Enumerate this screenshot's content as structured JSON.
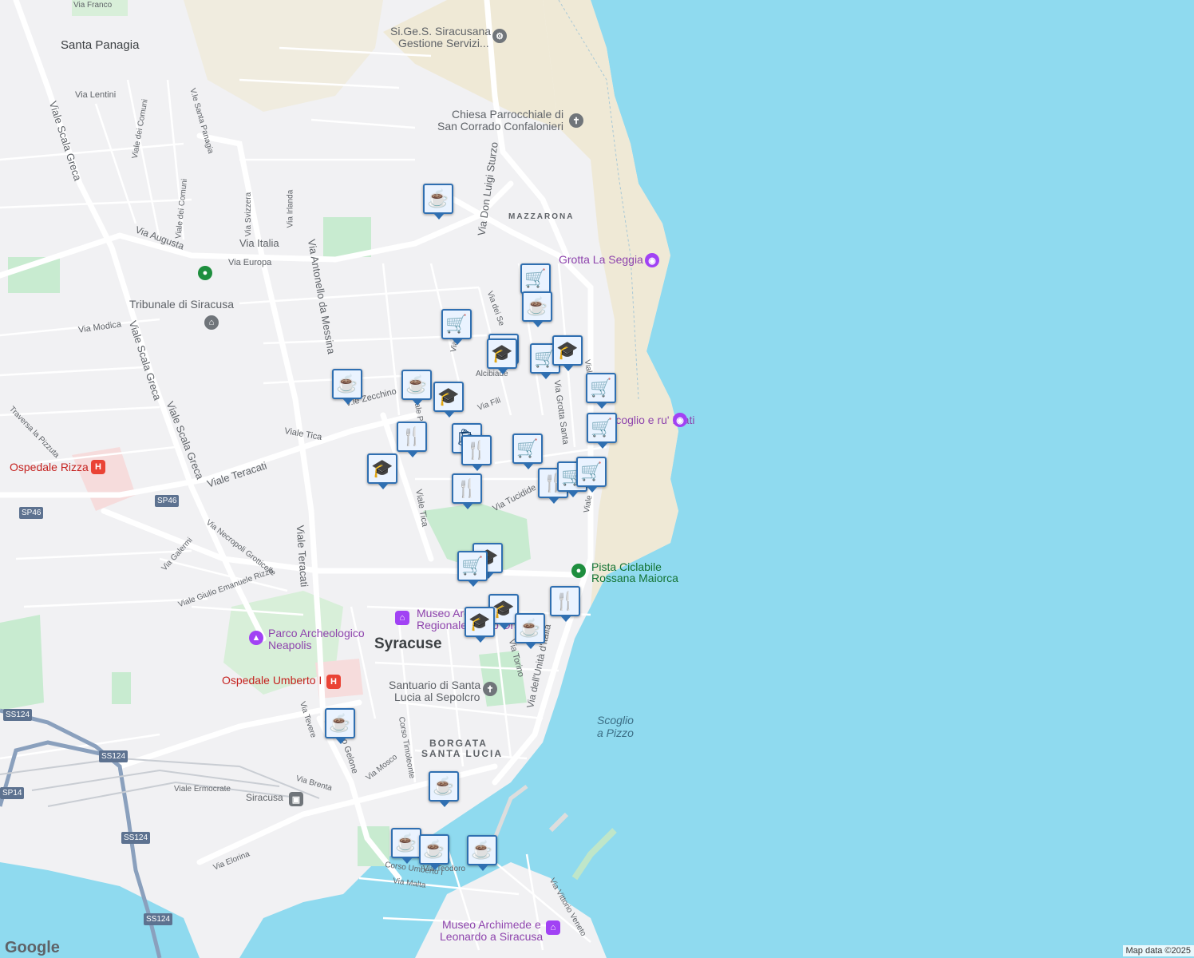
{
  "map": {
    "colors": {
      "sea": "#8fdaef",
      "land": "#f1f1f3",
      "road": "#ffffff",
      "park": "#c8ebd0",
      "beach": "#efe9d6",
      "highway": "#8aa0bd"
    },
    "labels": {
      "santa_panagia": "Santa Panagia",
      "syracuse": "Syracuse",
      "mazzarona": "MAZZARONA",
      "borgata": "BORGATA",
      "santa_lucia": "SANTA LUCIA",
      "scoglio_1": "Scoglio",
      "scoglio_2": "a Pizzo",
      "via_augusta": "Via Augusta",
      "via_italia": "Via Italia",
      "via_europa": "Via Europa",
      "via_lentini": "Via Lentini",
      "via_modica": "Via Modica",
      "viale_scala_greca_1": "Viale Scala Greca",
      "viale_scala_greca_2": "Viale Scala Greca",
      "viale_scala_greca_3": "Viale Scala Greca",
      "viale_teracati_1": "Viale Teracati",
      "viale_teracati_2": "Viale Teracati",
      "viale_tica_1": "Viale Tica",
      "viale_tica_2": "Viale Tica",
      "via_tucidide": "Via Tucidide",
      "via_grotta_santa": "Via Grotta Santa",
      "via_torino": "Via Torino",
      "via_unita": "Via dell'Unità d'Italia",
      "via_don_sturzo": "Via Don Luigi Sturzo",
      "via_antonello": "Via Antonello da Messina",
      "vle_zecchino": "V.le Zecchino",
      "via_irlanda": "Via Irlanda",
      "via_svizzera": "Via Svizzera",
      "viale_comuni_1": "Viale dei Comuni",
      "viale_comuni_2": "Viale dei Comuni",
      "vle_santa_panagia": "V.le Santa Panagia",
      "via_necropoli": "Via Necropoli Grotticelle",
      "via_galermi": "Via Galermi",
      "viale_giulio": "Viale Giulio Emanuele Rizzo",
      "traversa": "Traversa la Pizzuta",
      "via_tevere": "Via Tevere",
      "corso_gelone": "Corso Gelone",
      "via_mosco": "Via Mosco",
      "corso_timoleonte": "Corso Timoleonte",
      "via_brenta": "Via Brenta",
      "viale_ermocrate": "Viale Ermocrate",
      "via_elorina": "Via Elorina",
      "corso_umberto": "Corso Umberto I",
      "via_malta": "Via Malta",
      "via_vittorio_veneto": "Via Vittorio Veneto",
      "via_teodoro": "Via Teodoro",
      "via_francofonte": "Via Franco",
      "via_alcibiade": "Alcibiade",
      "via_fil_1": "Via Fili",
      "via_fil_2": "Via Fili",
      "via_del_sel": "Via dei Se",
      "viale_short": "Viale",
      "viale_short2": "Viale",
      "viale_paolo": "Viale Paolo",
      "sp46": "SP46",
      "ss124_1": "SS124",
      "ss124_2": "SS124",
      "ss124_3": "SS124",
      "ss124_4": "SS124",
      "sp14": "SP14"
    },
    "pois": {
      "sige_1": "Si.Ge.S. Siracusana",
      "sige_2": "Gestione Servizi...",
      "chiesa_1": "Chiesa Parrocchiale di",
      "chiesa_2": "San Corrado Confalonieri",
      "grotta": "Grotta La Seggia",
      "tribunale": "Tribunale di Siracusa",
      "ospedale_rizza": "Ospedale Rizza",
      "scoglio_frati": "Scoglio e ru' Frati",
      "pista_1": "Pista Ciclabile",
      "pista_2": "Rossana Maiorca",
      "museo_1": "Museo Archeologico",
      "museo_2": "Regionale Paolo Orsi",
      "parco_1": "Parco Archeologico",
      "parco_2": "Neapolis",
      "ospedale_umberto": "Ospedale Umberto I",
      "santuario_1": "Santuario di Santa",
      "santuario_2": "Lucia al Sepolcro",
      "siracusa_station": "Siracusa",
      "museo_arch_1": "Museo Archimede e",
      "museo_arch_2": "Leonardo a Siracusa"
    },
    "markers": [
      {
        "kind": "cafe",
        "icon": "coffee-cup-icon",
        "glyph": "☕"
      },
      {
        "kind": "shop",
        "icon": "shopping-cart-icon",
        "glyph": "🛒"
      },
      {
        "kind": "cafe",
        "icon": "coffee-cup-icon",
        "glyph": "☕"
      },
      {
        "kind": "shop",
        "icon": "shopping-cart-icon",
        "glyph": "🛒"
      },
      {
        "kind": "school",
        "icon": "graduation-cap-icon",
        "glyph": "🎓"
      },
      {
        "kind": "school",
        "icon": "graduation-cap-icon",
        "glyph": "🎓"
      },
      {
        "kind": "shop",
        "icon": "shopping-cart-icon",
        "glyph": "🛒"
      },
      {
        "kind": "school",
        "icon": "graduation-cap-icon",
        "glyph": "🎓"
      },
      {
        "kind": "cafe",
        "icon": "coffee-cup-icon",
        "glyph": "☕"
      },
      {
        "kind": "cafe",
        "icon": "coffee-cup-icon",
        "glyph": "☕"
      },
      {
        "kind": "school",
        "icon": "graduation-cap-icon",
        "glyph": "🎓"
      },
      {
        "kind": "shop",
        "icon": "shopping-cart-icon",
        "glyph": "🛒"
      },
      {
        "kind": "shop",
        "icon": "shopping-cart-icon",
        "glyph": "🛒"
      },
      {
        "kind": "restaurant",
        "icon": "fork-knife-icon",
        "glyph": "🍴"
      },
      {
        "kind": "shop",
        "icon": "shopping-bag-icon",
        "glyph": "🛍"
      },
      {
        "kind": "restaurant",
        "icon": "fork-knife-icon",
        "glyph": "🍴"
      },
      {
        "kind": "shop",
        "icon": "shopping-cart-icon",
        "glyph": "🛒"
      },
      {
        "kind": "school",
        "icon": "graduation-cap-icon",
        "glyph": "🎓"
      },
      {
        "kind": "restaurant",
        "icon": "fork-knife-icon",
        "glyph": "🍴"
      },
      {
        "kind": "restaurant",
        "icon": "fork-knife-icon",
        "glyph": "🍴"
      },
      {
        "kind": "shop",
        "icon": "shopping-cart-icon",
        "glyph": "🛒"
      },
      {
        "kind": "shop",
        "icon": "shopping-cart-icon",
        "glyph": "🛒"
      },
      {
        "kind": "school",
        "icon": "graduation-cap-icon",
        "glyph": "🎓"
      },
      {
        "kind": "shop",
        "icon": "shopping-cart-icon",
        "glyph": "🛒"
      },
      {
        "kind": "restaurant",
        "icon": "fork-knife-icon",
        "glyph": "🍴"
      },
      {
        "kind": "school",
        "icon": "graduation-cap-icon",
        "glyph": "🎓"
      },
      {
        "kind": "school",
        "icon": "graduation-cap-icon",
        "glyph": "🎓"
      },
      {
        "kind": "cafe",
        "icon": "coffee-cup-icon",
        "glyph": "☕"
      },
      {
        "kind": "cafe",
        "icon": "coffee-cup-icon",
        "glyph": "☕"
      },
      {
        "kind": "cafe",
        "icon": "coffee-cup-icon",
        "glyph": "☕"
      },
      {
        "kind": "cafe",
        "icon": "coffee-cup-icon",
        "glyph": "☕"
      },
      {
        "kind": "cafe",
        "icon": "coffee-cup-icon",
        "glyph": "☕"
      },
      {
        "kind": "cafe",
        "icon": "coffee-cup-icon",
        "glyph": "☕"
      }
    ],
    "logo": "Google",
    "attribution": "Map data ©2025"
  }
}
